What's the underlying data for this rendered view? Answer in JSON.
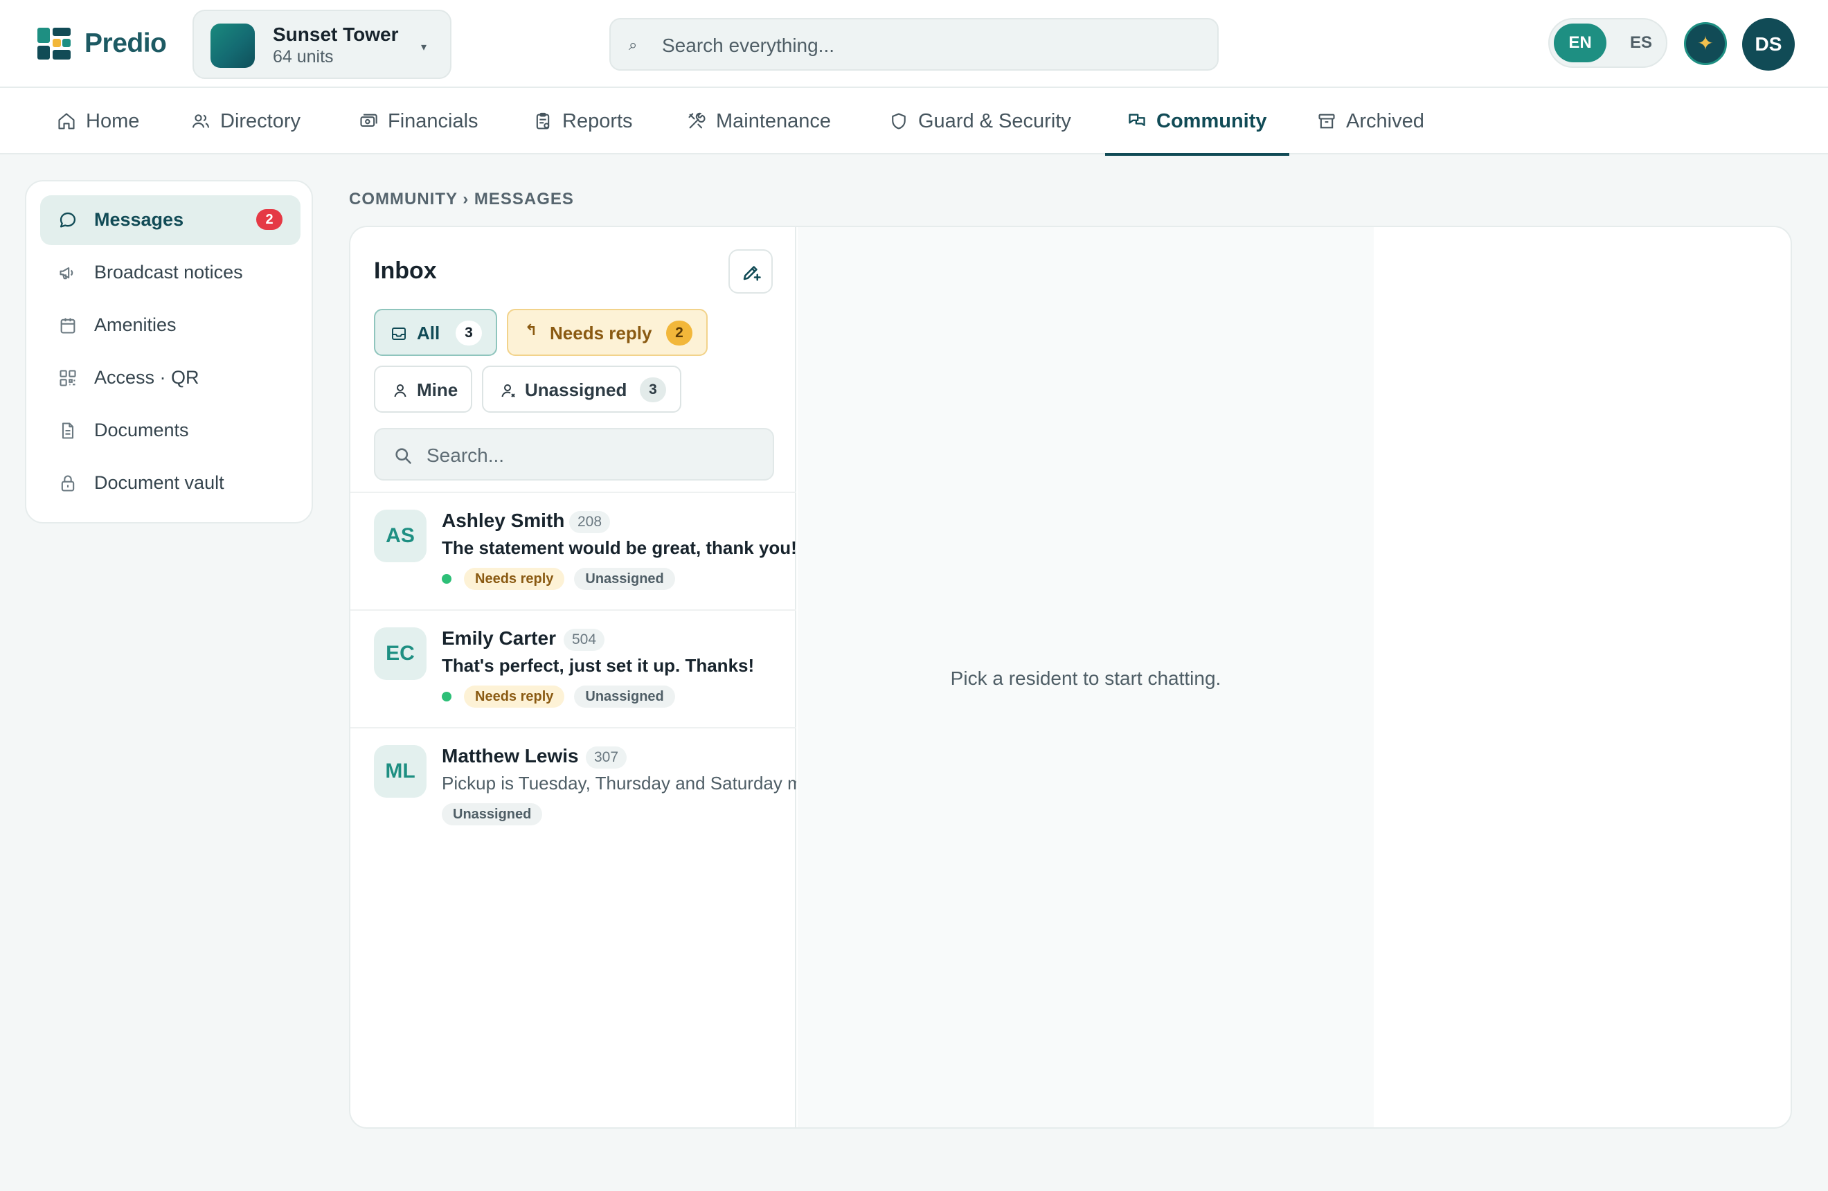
{
  "app": {
    "name": "Predio",
    "colors": {
      "brand": "#114b56",
      "accent": "#1e8f82",
      "danger": "#e53945",
      "warning": "#f2b73a"
    }
  },
  "property": {
    "name": "Sunset Tower",
    "units": "64 units",
    "caret": "▾"
  },
  "search": {
    "icon": "⌕",
    "placeholder": "Search everything..."
  },
  "language": {
    "active": "EN",
    "other": "ES"
  },
  "assistant": {
    "icon": "✦"
  },
  "user": {
    "initials": "DS"
  },
  "nav": {
    "tabs": [
      {
        "label": "Home",
        "icon": "home-icon"
      },
      {
        "label": "Directory",
        "icon": "users-icon"
      },
      {
        "label": "Financials",
        "icon": "money-icon"
      },
      {
        "label": "Reports",
        "icon": "clipboard-icon"
      },
      {
        "label": "Maintenance",
        "icon": "tools-icon"
      },
      {
        "label": "Guard & Security",
        "icon": "shield-icon"
      },
      {
        "label": "Community",
        "icon": "chat-icon",
        "active": true
      },
      {
        "label": "Archived",
        "icon": "archive-icon"
      }
    ]
  },
  "sidebar": {
    "items": [
      {
        "label": "Messages",
        "icon": "message-icon",
        "badge": "2",
        "active": true
      },
      {
        "label": "Broadcast notices",
        "icon": "megaphone-icon"
      },
      {
        "label": "Amenities",
        "icon": "calendar-icon"
      },
      {
        "label": "Access · QR",
        "icon": "qr-icon"
      },
      {
        "label": "Documents",
        "icon": "document-icon"
      },
      {
        "label": "Document vault",
        "icon": "lock-icon"
      }
    ]
  },
  "breadcrumb": "COMMUNITY › MESSAGES",
  "inbox": {
    "title": "Inbox",
    "filters": {
      "all": {
        "label": "All",
        "count": "3"
      },
      "needs_reply": {
        "label": "Needs reply",
        "count": "2",
        "icon": "↰"
      },
      "mine": {
        "label": "Mine"
      },
      "unassigned": {
        "label": "Unassigned",
        "count": "3"
      }
    },
    "search_placeholder": "Search...",
    "conversations": [
      {
        "initials": "AS",
        "name": "Ashley Smith",
        "unit": "208",
        "preview": "The statement would be great, thank you!",
        "unread": true,
        "tags": [
          "Needs reply",
          "Unassigned"
        ]
      },
      {
        "initials": "EC",
        "name": "Emily Carter",
        "unit": "504",
        "preview": "That's perfect, just set it up. Thanks!",
        "unread": true,
        "tags": [
          "Needs reply",
          "Unassigned"
        ]
      },
      {
        "initials": "ML",
        "name": "Matthew Lewis",
        "unit": "307",
        "preview": "Pickup is Tuesday, Thursday and Saturday mornings.",
        "unread": false,
        "tags": [
          "Unassigned"
        ]
      }
    ]
  },
  "chat": {
    "empty_message": "Pick a resident to start chatting."
  }
}
